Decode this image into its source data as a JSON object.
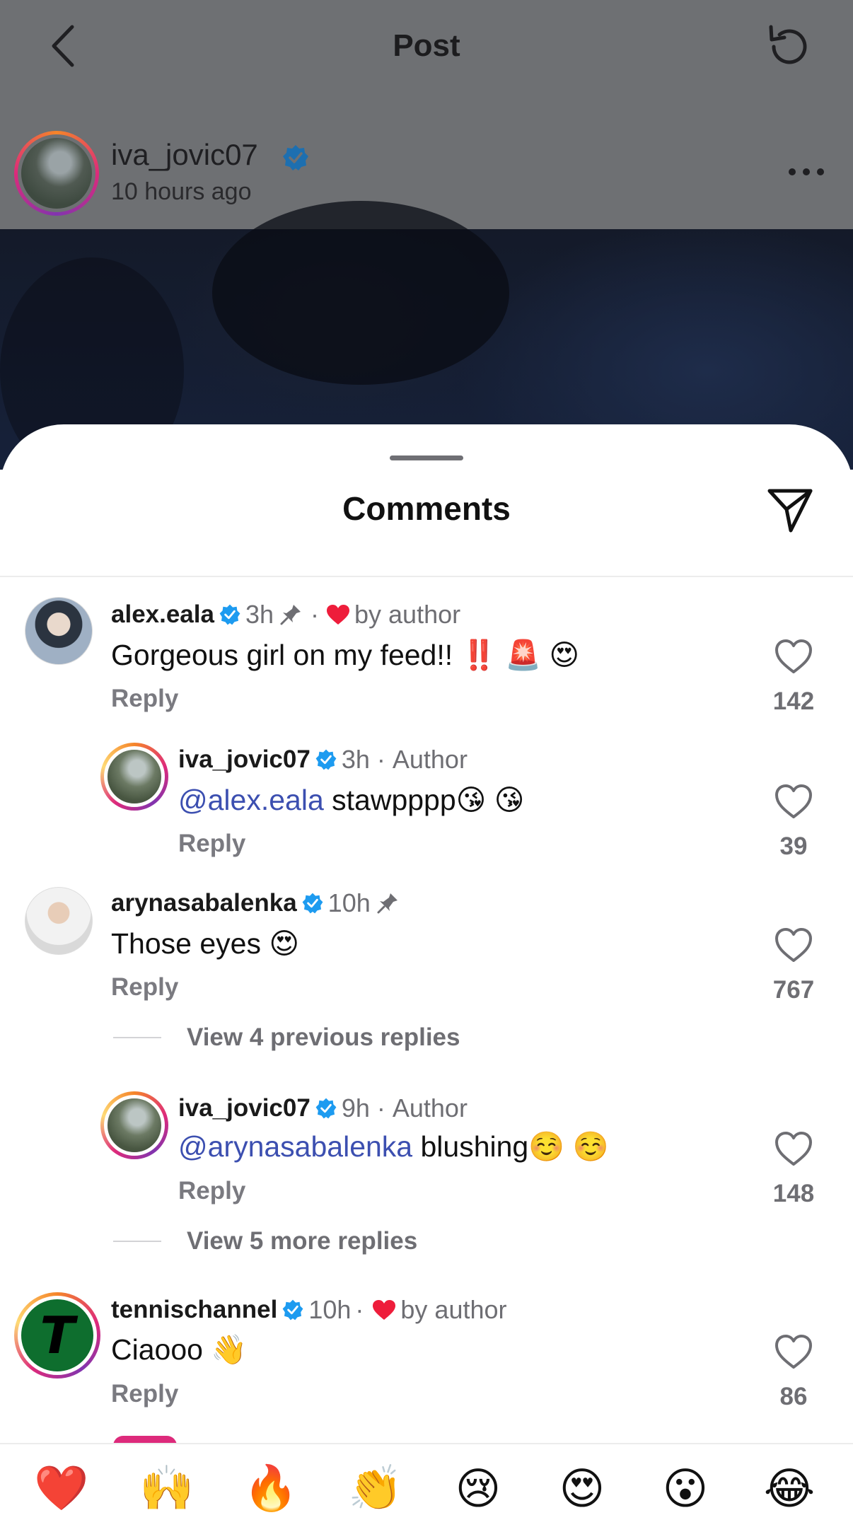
{
  "header": {
    "title": "Post"
  },
  "post": {
    "username": "iva_jovic07",
    "time": "10 hours ago"
  },
  "sheet": {
    "title": "Comments"
  },
  "comments": [
    {
      "username": "alex.eala",
      "time": "3h",
      "pinned": true,
      "liked_by_author_label": "by author",
      "text": "Gorgeous girl on my feed!! ‼️ 🚨 😍",
      "reply_label": "Reply",
      "likes": "142"
    },
    {
      "username": "iva_jovic07",
      "time": "3h",
      "author_label": "Author",
      "mention": "@alex.eala",
      "text": " stawpppp😘 😘",
      "reply_label": "Reply",
      "likes": "39"
    },
    {
      "username": "arynasabalenka",
      "time": "10h",
      "pinned": true,
      "text": "Those eyes 😍",
      "reply_label": "Reply",
      "likes": "767",
      "view_previous": "View 4 previous replies"
    },
    {
      "username": "iva_jovic07",
      "time": "9h",
      "author_label": "Author",
      "mention": "@arynasabalenka",
      "text": " blushing☺️ ☺️",
      "reply_label": "Reply",
      "likes": "148",
      "view_more": "View 5 more replies"
    },
    {
      "username": "tennischannel",
      "time": "10h",
      "liked_by_author_label": "by author",
      "text": "Ciaooo 👋",
      "reply_label": "Reply",
      "likes": "86"
    }
  ],
  "emoji_bar": [
    "❤️",
    "🙌",
    "🔥",
    "👏",
    "😢",
    "😍",
    "😮",
    "😂"
  ],
  "colors": {
    "verified": "#1d9bf0",
    "heart_red": "#ee1d3b",
    "mention": "#3c4fb0",
    "story_ring": [
      "#f58529",
      "#dd2a7b",
      "#8134af"
    ]
  }
}
